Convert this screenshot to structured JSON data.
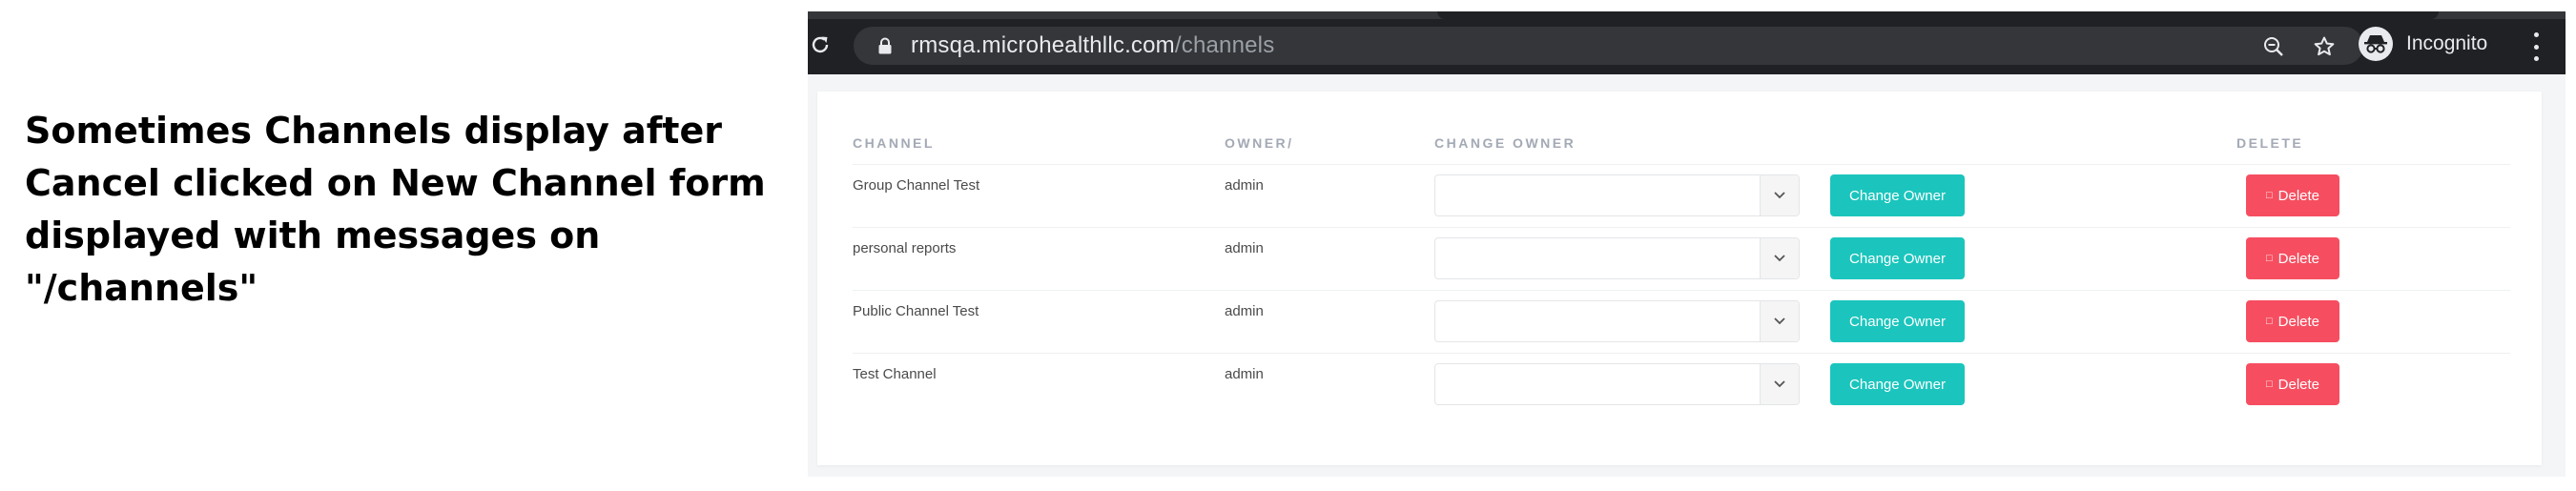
{
  "caption": {
    "line1": "Sometimes Channels display after",
    "line2": "Cancel clicked on New Channel form",
    "line3": "displayed with messages on \"/channels\""
  },
  "browser": {
    "url_host": "rmsqa.microhealthllc.com",
    "url_path": "/channels",
    "profile_label": "Incognito",
    "icons": [
      "reload-icon",
      "lock-icon",
      "zoom-out-icon",
      "star-icon",
      "incognito-icon",
      "menu-icon"
    ]
  },
  "table": {
    "headers": {
      "channel": "CHANNEL",
      "owner": "OWNER/",
      "change_owner": "CHANGE OWNER",
      "delete": "DELETE"
    },
    "rows": [
      {
        "channel": "Group Channel Test",
        "owner": "admin",
        "select_value": "",
        "change_label": "Change Owner",
        "delete_icon": "□",
        "delete_label": "Delete"
      },
      {
        "channel": "personal reports",
        "owner": "admin",
        "select_value": "",
        "change_label": "Change Owner",
        "delete_icon": "□",
        "delete_label": "Delete"
      },
      {
        "channel": "Public Channel Test",
        "owner": "admin",
        "select_value": "",
        "change_label": "Change Owner",
        "delete_icon": "□",
        "delete_label": "Delete"
      },
      {
        "channel": "Test Channel",
        "owner": "admin",
        "select_value": "",
        "change_label": "Change Owner",
        "delete_icon": "□",
        "delete_label": "Delete"
      }
    ]
  },
  "colors": {
    "chrome_bg": "#202124",
    "omnibox_bg": "#35363a",
    "change_owner_btn": "#1bc5bd",
    "delete_btn": "#f64e60",
    "header_text": "#a3a9b5"
  }
}
